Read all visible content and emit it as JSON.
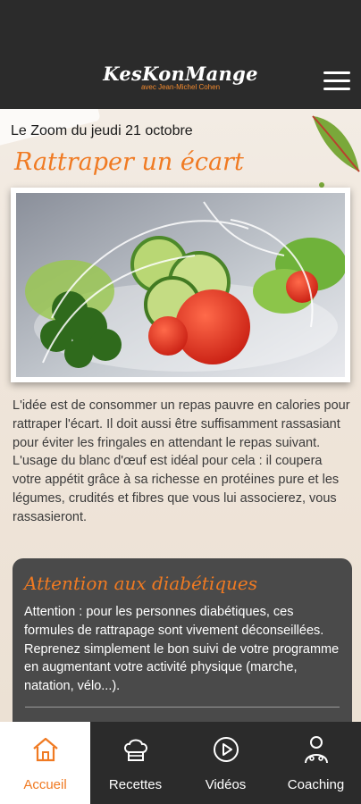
{
  "header": {
    "logo_title": "KesKonMange",
    "logo_subtitle": "avec Jean-Michel Cohen",
    "menu_icon": "hamburger-menu-icon"
  },
  "article": {
    "zoom_date": "Le Zoom du jeudi 21 octobre",
    "title": "Rattraper un écart",
    "intro": "L'idée est de consommer un repas pauvre en calories pour rattraper l'écart. Il doit aussi être suffisamment rassasiant pour éviter les fringales en attendant le repas suivant. L'usage du blanc d'œuf est idéal pour cela : il coupera votre appétit grâce à sa richesse en protéines pure et les légumes, crudités et fibres que vous lui associerez, vous rassasieront.",
    "warning": {
      "title": "Attention aux diabétiques",
      "text": "Attention : pour les personnes diabétiques, ces formules de rattrapage sont vivement déconseillées. Reprenez simplement le bon suivi de votre programme en augmentant votre activité physique (marche, natation, vélo...)."
    }
  },
  "nav": {
    "items": [
      {
        "label": "Accueil",
        "icon": "home-icon",
        "active": true
      },
      {
        "label": "Recettes",
        "icon": "chef-hat-icon",
        "active": false
      },
      {
        "label": "Vidéos",
        "icon": "play-icon",
        "active": false
      },
      {
        "label": "Coaching",
        "icon": "coach-icon",
        "active": false
      }
    ]
  },
  "colors": {
    "accent": "#f07a22",
    "dark": "#2b2b2b",
    "warning_bg": "#4a4a4a"
  }
}
